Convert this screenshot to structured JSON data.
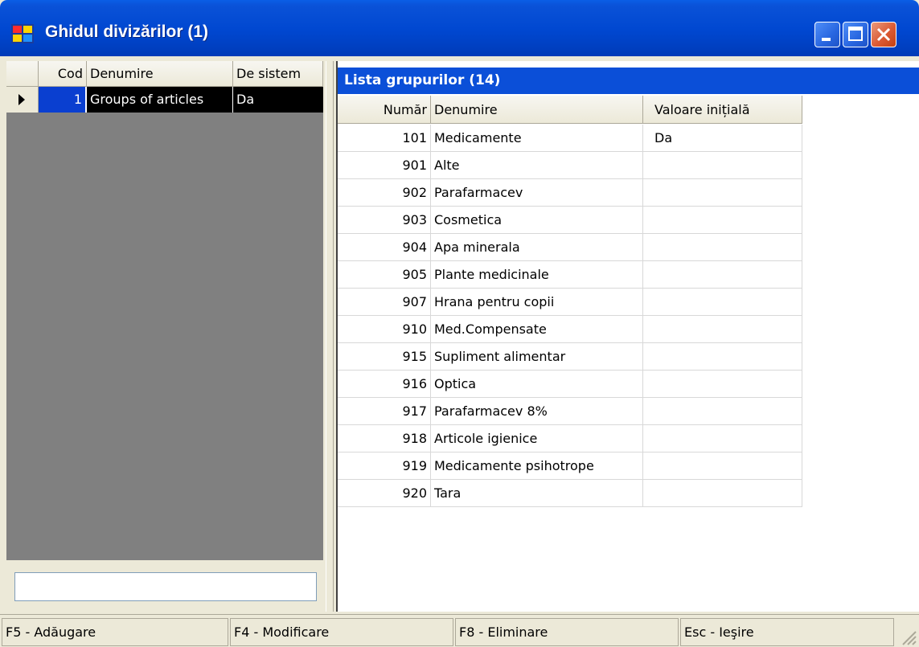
{
  "window": {
    "title": "Ghidul divizărilor (1)",
    "title_bar_color": "#0a52d8",
    "controls": [
      "minimize-icon",
      "maximize-icon",
      "close-icon"
    ]
  },
  "divisions_grid": {
    "columns": [
      "Cod",
      "Denumire",
      "De sistem"
    ],
    "rows": [
      {
        "code": "1",
        "name": "Groups of articles",
        "system": "Da",
        "selected": true
      }
    ],
    "filter_value": ""
  },
  "groups_list": {
    "caption": "Lista grupurilor (14)",
    "columns": [
      "Număr",
      "Denumire",
      "Valoare inițială"
    ],
    "rows": [
      {
        "number": "101",
        "name": "Medicamente",
        "initial": "Da"
      },
      {
        "number": "901",
        "name": "Alte",
        "initial": ""
      },
      {
        "number": "902",
        "name": "Parafarmacev",
        "initial": ""
      },
      {
        "number": "903",
        "name": "Cosmetica",
        "initial": ""
      },
      {
        "number": "904",
        "name": "Apa minerala",
        "initial": ""
      },
      {
        "number": "905",
        "name": "Plante medicinale",
        "initial": ""
      },
      {
        "number": "907",
        "name": "Hrana pentru copii",
        "initial": ""
      },
      {
        "number": "910",
        "name": "Med.Compensate",
        "initial": ""
      },
      {
        "number": "915",
        "name": "Supliment alimentar",
        "initial": ""
      },
      {
        "number": "916",
        "name": "Optica",
        "initial": ""
      },
      {
        "number": "917",
        "name": "Parafarmacev 8%",
        "initial": ""
      },
      {
        "number": "918",
        "name": "Articole igienice",
        "initial": ""
      },
      {
        "number": "919",
        "name": "Medicamente psihotrope",
        "initial": ""
      },
      {
        "number": "920",
        "name": "Tara",
        "initial": ""
      }
    ]
  },
  "status_bar": {
    "items": [
      "F5 - Adăugare",
      "F4 - Modificare",
      "F8 - Eliminare",
      "Esc - Ieşire"
    ]
  }
}
